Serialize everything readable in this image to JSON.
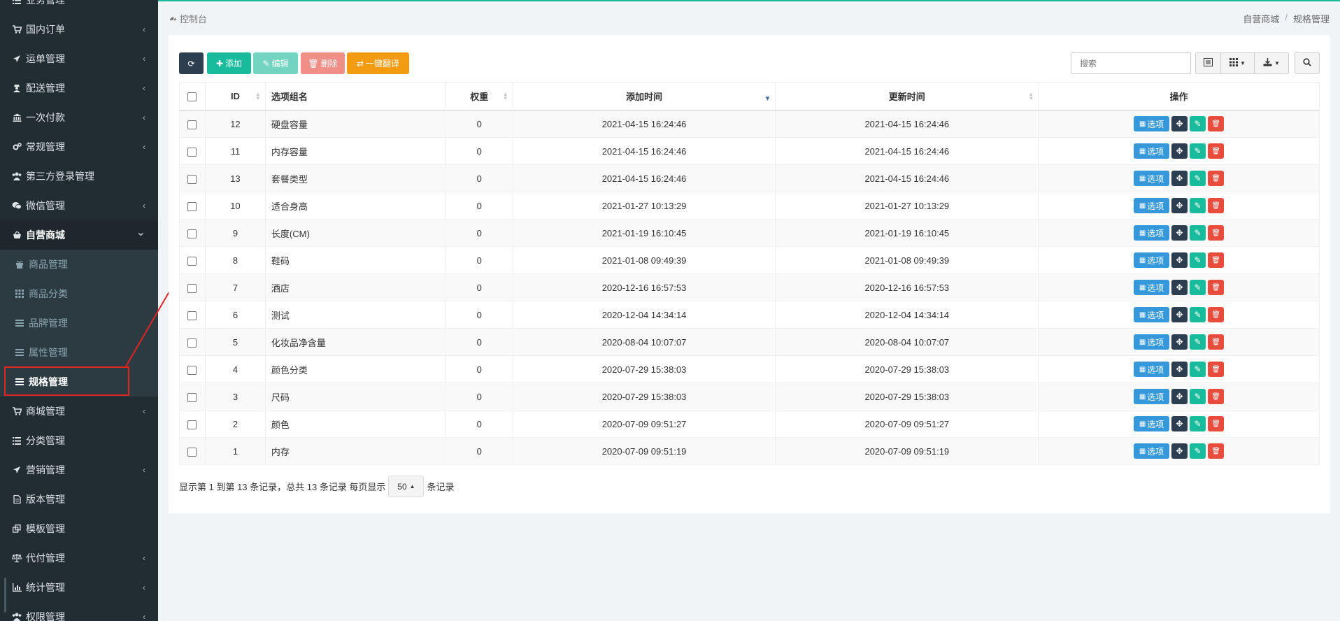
{
  "sidebar": {
    "items": [
      {
        "label": "业务管理",
        "icon": "list-icon",
        "chevron": false
      },
      {
        "label": "国内订单",
        "icon": "cart-icon",
        "chevron": true
      },
      {
        "label": "运单管理",
        "icon": "plane-icon",
        "chevron": true
      },
      {
        "label": "配送管理",
        "icon": "user-secret-icon",
        "chevron": true
      },
      {
        "label": "一次付款",
        "icon": "bank-icon",
        "chevron": true
      },
      {
        "label": "常规管理",
        "icon": "cogs-icon",
        "chevron": true
      },
      {
        "label": "第三方登录管理",
        "icon": "users-icon",
        "chevron": false
      },
      {
        "label": "微信管理",
        "icon": "wechat-icon",
        "chevron": true
      },
      {
        "label": "自营商城",
        "icon": "basket-icon",
        "chevron": true,
        "open": true
      }
    ],
    "sub_items": [
      {
        "label": "商品管理",
        "icon": "gift-icon"
      },
      {
        "label": "商品分类",
        "icon": "th-icon"
      },
      {
        "label": "品牌管理",
        "icon": "bars-icon"
      },
      {
        "label": "属性管理",
        "icon": "bars-icon"
      },
      {
        "label": "规格管理",
        "icon": "bars-icon",
        "active": true
      }
    ],
    "items_after": [
      {
        "label": "商城管理",
        "icon": "cart-icon",
        "chevron": true
      },
      {
        "label": "分类管理",
        "icon": "list-icon",
        "chevron": false
      },
      {
        "label": "营销管理",
        "icon": "send-icon",
        "chevron": true
      },
      {
        "label": "版本管理",
        "icon": "file-icon",
        "chevron": false
      },
      {
        "label": "模板管理",
        "icon": "clone-icon",
        "chevron": false
      },
      {
        "label": "代付管理",
        "icon": "balance-icon",
        "chevron": true
      },
      {
        "label": "统计管理",
        "icon": "bar-chart-icon",
        "chevron": true
      },
      {
        "label": "权限管理",
        "icon": "group-icon",
        "chevron": true
      }
    ]
  },
  "header": {
    "breadcrumb_left": "控制台",
    "breadcrumb_right": [
      "自营商城",
      "规格管理"
    ]
  },
  "toolbar": {
    "add": "添加",
    "edit": "编辑",
    "delete": "删除",
    "translate": "一键翻译",
    "search_placeholder": "搜索"
  },
  "table": {
    "columns": [
      "ID",
      "选项组名",
      "权重",
      "添加时间",
      "更新时间",
      "操作"
    ],
    "rows": [
      {
        "id": "12",
        "name": "硬盘容量",
        "weight": "0",
        "created": "2021-04-15 16:24:46",
        "updated": "2021-04-15 16:24:46"
      },
      {
        "id": "11",
        "name": "内存容量",
        "weight": "0",
        "created": "2021-04-15 16:24:46",
        "updated": "2021-04-15 16:24:46"
      },
      {
        "id": "13",
        "name": "套餐类型",
        "weight": "0",
        "created": "2021-04-15 16:24:46",
        "updated": "2021-04-15 16:24:46"
      },
      {
        "id": "10",
        "name": "适合身高",
        "weight": "0",
        "created": "2021-01-27 10:13:29",
        "updated": "2021-01-27 10:13:29"
      },
      {
        "id": "9",
        "name": "长度(CM)",
        "weight": "0",
        "created": "2021-01-19 16:10:45",
        "updated": "2021-01-19 16:10:45"
      },
      {
        "id": "8",
        "name": "鞋码",
        "weight": "0",
        "created": "2021-01-08 09:49:39",
        "updated": "2021-01-08 09:49:39"
      },
      {
        "id": "7",
        "name": "酒店",
        "weight": "0",
        "created": "2020-12-16 16:57:53",
        "updated": "2020-12-16 16:57:53"
      },
      {
        "id": "6",
        "name": "测试",
        "weight": "0",
        "created": "2020-12-04 14:34:14",
        "updated": "2020-12-04 14:34:14"
      },
      {
        "id": "5",
        "name": "化妆品净含量",
        "weight": "0",
        "created": "2020-08-04 10:07:07",
        "updated": "2020-08-04 10:07:07"
      },
      {
        "id": "4",
        "name": "颜色分类",
        "weight": "0",
        "created": "2020-07-29 15:38:03",
        "updated": "2020-07-29 15:38:03"
      },
      {
        "id": "3",
        "name": "尺码",
        "weight": "0",
        "created": "2020-07-29 15:38:03",
        "updated": "2020-07-29 15:38:03"
      },
      {
        "id": "2",
        "name": "颜色",
        "weight": "0",
        "created": "2020-07-09 09:51:27",
        "updated": "2020-07-09 09:51:27"
      },
      {
        "id": "1",
        "name": "内存",
        "weight": "0",
        "created": "2020-07-09 09:51:19",
        "updated": "2020-07-09 09:51:19"
      }
    ],
    "option_button": "选项"
  },
  "pagination": {
    "summary": "显示第 1 到第 13 条记录，总共 13 条记录 每页显示",
    "page_size": "50",
    "suffix": "条记录"
  },
  "colors": {
    "sidebar_bg": "#222d32",
    "accent": "#18bc9c",
    "primary_dark": "#2c3e50",
    "danger": "#e74c3c",
    "info": "#3498db",
    "warning": "#f39c12",
    "annotation": "#e02424"
  }
}
